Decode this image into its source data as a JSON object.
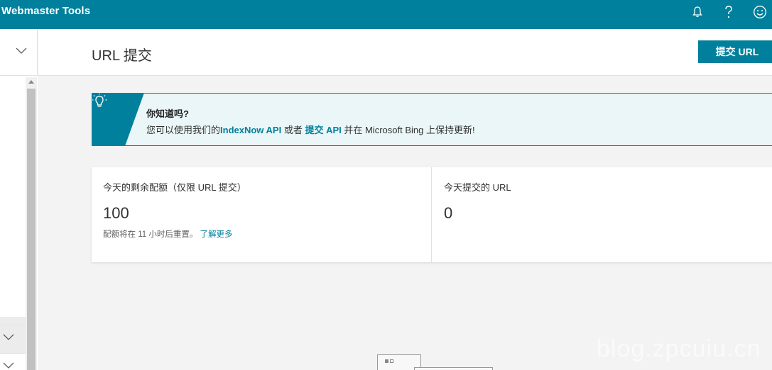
{
  "app": {
    "title": "Webmaster Tools"
  },
  "topbar_icons": [
    "bell-icon",
    "help-icon",
    "smiley-feedback-icon"
  ],
  "header": {
    "title": "URL 提交",
    "submit_label": "提交 URL"
  },
  "banner": {
    "title": "你知道吗?",
    "text_prefix": "您可以使用我们的",
    "link1": "IndexNow API",
    "text_mid": " 或者 ",
    "link2": "提交 API",
    "text_suffix": " 并在 Microsoft Bing 上保持更新!"
  },
  "quota_card": {
    "label": "今天的剩余配额（仅限 URL 提交）",
    "value": "100",
    "note": "配额将在 11 小时后重置。",
    "note_link": "了解更多"
  },
  "submitted_card": {
    "label": "今天提交的 URL",
    "value": "0"
  },
  "watermark": "blog.zpcuiu.cn",
  "colors": {
    "brand": "#00809d",
    "banner_bg": "#eaf6f8"
  }
}
